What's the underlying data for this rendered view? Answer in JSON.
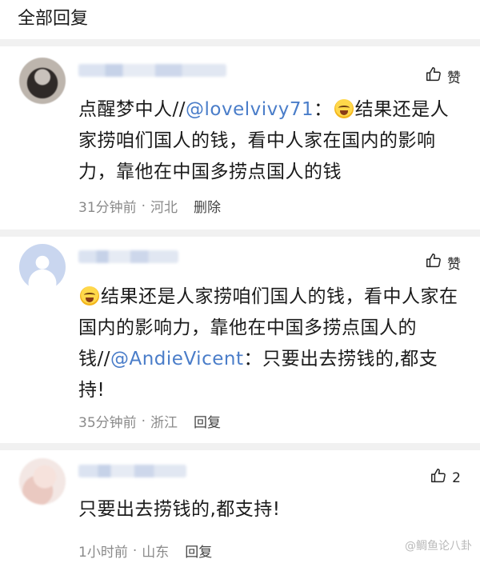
{
  "header": {
    "title": "全部回复"
  },
  "comments": [
    {
      "like_label": "赞",
      "text_before": "点醒梦中人//",
      "mention": "@lovelvivy71",
      "text_after": "：",
      "text_tail": "结果还是人家捞咱们国人的钱，看中人家在国内的影响力，靠他在中国多捞点国人的钱",
      "time": "31分钟前",
      "sep": "·",
      "location": "河北",
      "action": "删除"
    },
    {
      "like_label": "赞",
      "text_before": "结果还是人家捞咱们国人的钱，看中人家在国内的影响力，靠他在中国多捞点国人的钱//",
      "mention": "@AndieVicent",
      "text_after": "：只要出去捞钱的,都支持!",
      "time": "35分钟前",
      "sep": "·",
      "location": "浙江",
      "action": "回复"
    },
    {
      "like_label": "2",
      "text": "只要出去捞钱的,都支持!",
      "time": "1小时前",
      "sep": "·",
      "location": "山东",
      "action": "回复"
    }
  ],
  "watermark": {
    "text": "@鲷鱼论八卦"
  },
  "colors": {
    "mention": "#4a7dc9",
    "meta": "#8a8a8a",
    "divider": "#f1f1f1"
  }
}
